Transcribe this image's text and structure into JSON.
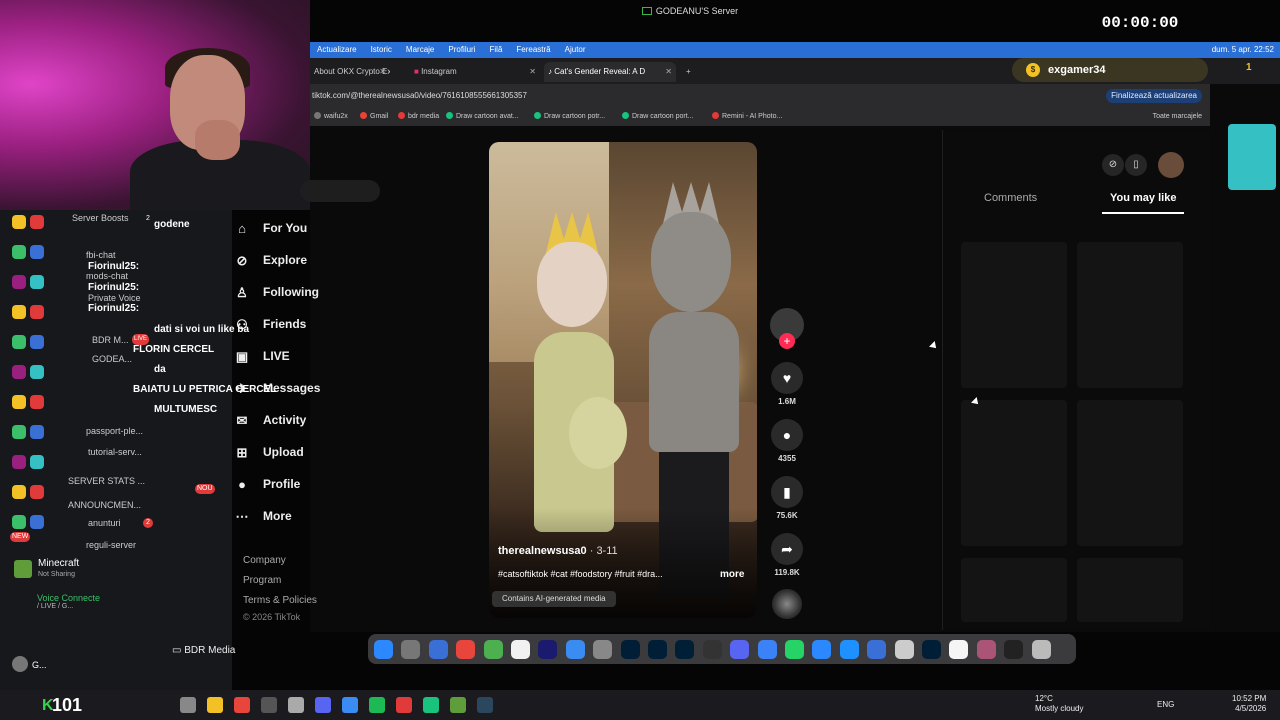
{
  "stream": {
    "window_title": "GODEANU'S Server",
    "timer": "00:00:00"
  },
  "browser": {
    "menu": [
      "Actualizare",
      "Istoric",
      "Marcaje",
      "Profiluri",
      "Filă",
      "Fereastră",
      "Ajutor"
    ],
    "menu_status": "dum. 5 apr. 22:52",
    "tabs": [
      {
        "label": "About OKX Crypto Exc",
        "active": false
      },
      {
        "label": "Instagram",
        "active": false
      },
      {
        "label": "Cat's Gender Reveal: A D",
        "active": true
      }
    ],
    "new_tab": "+",
    "url": "tiktok.com/@therealnewsusa0/video/7616108555661305357",
    "update_button": "Finalizează actualizarea",
    "bookmarks": [
      {
        "label": "waifu2x",
        "color": "#777777"
      },
      {
        "label": "Gmail",
        "color": "#ea4335"
      },
      {
        "label": "bdr media",
        "color": "#e03a3a"
      },
      {
        "label": "Draw cartoon avat...",
        "color": "#19c37d"
      },
      {
        "label": "Draw cartoon potr...",
        "color": "#19c37d"
      },
      {
        "label": "Draw cartoon port...",
        "color": "#19c37d"
      },
      {
        "label": "Remini - AI Photo...",
        "color": "#e03a3a"
      }
    ],
    "bookmarks_all": "Toate marcajele"
  },
  "tiktok": {
    "nav": [
      {
        "label": "For You",
        "icon": "home-icon",
        "glyph": "⌂"
      },
      {
        "label": "Explore",
        "icon": "compass-icon",
        "glyph": "⊘"
      },
      {
        "label": "Following",
        "icon": "person-icon",
        "glyph": "♙"
      },
      {
        "label": "Friends",
        "icon": "friends-icon",
        "glyph": "⚇"
      },
      {
        "label": "LIVE",
        "icon": "live-icon",
        "glyph": "▣"
      },
      {
        "label": "Messages",
        "icon": "message-icon",
        "glyph": "✈"
      },
      {
        "label": "Activity",
        "icon": "bell-icon",
        "glyph": "✉"
      },
      {
        "label": "Upload",
        "icon": "upload-icon",
        "glyph": "⊞"
      },
      {
        "label": "Profile",
        "icon": "avatar-icon",
        "glyph": "●"
      },
      {
        "label": "More",
        "icon": "more-icon",
        "glyph": "⋯"
      }
    ],
    "footer": [
      "Company",
      "Program",
      "Terms & Policies"
    ],
    "copyright": "© 2026 TikTok",
    "video": {
      "author": "therealnewsusa0",
      "date": "· 3-11",
      "tags": "#catsoftiktok #cat #foodstory #fruit #dra...",
      "more": "more",
      "ai_label": "Contains AI-generated media"
    },
    "actions": {
      "likes": "1.6M",
      "comments": "4355",
      "saves": "75.6K",
      "shares": "119.8K"
    },
    "panel": {
      "tab_comments": "Comments",
      "tab_you_may_like": "You may like"
    }
  },
  "discord": {
    "lines": [
      {
        "text": "Server Boosts",
        "cls": "chan"
      },
      {
        "text": "godene",
        "cls": "bold"
      },
      {
        "text": "fbi-chat",
        "cls": "chan"
      },
      {
        "text": "Fiorinul25:",
        "cls": "bold"
      },
      {
        "text": "mods-chat",
        "cls": "chan"
      },
      {
        "text": "Fiorinul25:",
        "cls": "bold"
      },
      {
        "text": "Private Voice",
        "cls": "chan"
      },
      {
        "text": "Fiorinul25:",
        "cls": "bold"
      },
      {
        "text": "dati si voi un like ba",
        "cls": "bold"
      },
      {
        "text": "BDR M...",
        "cls": "chan"
      },
      {
        "text": "FLORIN CERCEL",
        "cls": "bold"
      },
      {
        "text": "GODEA...",
        "cls": "chan"
      },
      {
        "text": "da",
        "cls": "bold"
      },
      {
        "text": "BAIATU LU PETRICA CERCEL",
        "cls": "bold"
      },
      {
        "text": "MULTUMESC",
        "cls": "bold"
      },
      {
        "text": "passport-ple...",
        "cls": "chan"
      },
      {
        "text": "tutorial-serv...",
        "cls": "chan"
      },
      {
        "text": "SERVER STATS ...",
        "cls": "chan"
      },
      {
        "text": "ANNOUNCMEN...",
        "cls": "chan"
      },
      {
        "text": "anunturi",
        "cls": "chan"
      },
      {
        "text": "reguli-server",
        "cls": "chan"
      }
    ],
    "live_badge": "LIVE",
    "nou_badge": "NOU",
    "new_badge": "NEW",
    "boost_count": "2",
    "anunturi_count": "2",
    "minecraft_title": "Minecraft",
    "minecraft_sub": "Not Sharing",
    "voice_title": "Voice Connecte",
    "voice_sub": "/ LIVE / G...",
    "user": "G..."
  },
  "bdr_media": "BDR Media",
  "notification": {
    "user": "exgamer34",
    "count": "1"
  },
  "taskbar": {
    "counter": "101",
    "weather_temp": "12°C",
    "weather_desc": "Mostly cloudy",
    "lang": "ENG",
    "time": "10:52 PM",
    "date": "4/5/2026"
  }
}
